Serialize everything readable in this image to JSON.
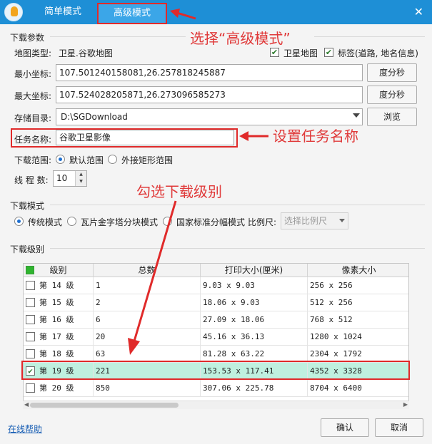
{
  "window": {
    "tabs": [
      {
        "label": "简单模式"
      },
      {
        "label": "高级模式"
      }
    ],
    "close_glyph": "✕"
  },
  "download_params": {
    "group_title": "下载参数",
    "map_type_label": "地图类型:",
    "map_type_value": "卫星.谷歌地图",
    "satellite_map_label": "卫星地图",
    "satellite_map_checked": true,
    "labels_label": "标签(道路, 地名信息)",
    "labels_checked": true,
    "min_coord_label": "最小坐标:",
    "min_coord_value": "107.501240158081,26.257818245887",
    "max_coord_label": "最大坐标:",
    "max_coord_value": "107.524028205871,26.273096585273",
    "dms_button": "度分秒",
    "storage_label": "存储目录:",
    "storage_value": "D:\\SGDownload",
    "browse_button": "浏览",
    "task_name_label": "任务名称:",
    "task_name_value": "谷歌卫星影像",
    "range_label": "下载范围:",
    "range_options": [
      {
        "label": "默认范围",
        "selected": true
      },
      {
        "label": "外接矩形范围",
        "selected": false
      }
    ],
    "threads_label": "线 程 数:",
    "threads_value": "10"
  },
  "download_mode": {
    "group_title": "下载模式",
    "options": [
      {
        "label": "传统模式",
        "selected": true
      },
      {
        "label": "瓦片金字塔分块模式",
        "selected": false
      },
      {
        "label": "国家标准分幅模式",
        "selected": false
      }
    ],
    "scale_label": "比例尺:",
    "scale_placeholder": "选择比例尺"
  },
  "download_levels": {
    "group_title": "下载级别",
    "columns": [
      "级别",
      "总数",
      "打印大小(厘米)",
      "像素大小"
    ],
    "rows": [
      {
        "level": "第 14 级",
        "total": "1",
        "print": "9.03 x 9.03",
        "pixel": "256 x 256",
        "checked": false
      },
      {
        "level": "第 15 级",
        "total": "2",
        "print": "18.06 x 9.03",
        "pixel": "512 x 256",
        "checked": false
      },
      {
        "level": "第 16 级",
        "total": "6",
        "print": "27.09 x 18.06",
        "pixel": "768 x 512",
        "checked": false
      },
      {
        "level": "第 17 级",
        "total": "20",
        "print": "45.16 x 36.13",
        "pixel": "1280 x 1024",
        "checked": false
      },
      {
        "level": "第 18 级",
        "total": "63",
        "print": "81.28 x 63.22",
        "pixel": "2304 x 1792",
        "checked": false
      },
      {
        "level": "第 19 级",
        "total": "221",
        "print": "153.53 x 117.41",
        "pixel": "4352 x 3328",
        "checked": true
      },
      {
        "level": "第 20 级",
        "total": "850",
        "print": "307.06 x 225.78",
        "pixel": "8704 x 6400",
        "checked": false
      }
    ]
  },
  "footer": {
    "help_link": "在线帮助",
    "ok_button": "确认",
    "cancel_button": "取消"
  },
  "annotations": {
    "select_advanced": "选择“高级模式”",
    "set_task_name": "设置任务名称",
    "check_level": "勾选下载级别"
  },
  "colors": {
    "titlebar": "#1e8fd6",
    "highlight_box": "#e02a2a",
    "selected_row": "#bff0df"
  }
}
